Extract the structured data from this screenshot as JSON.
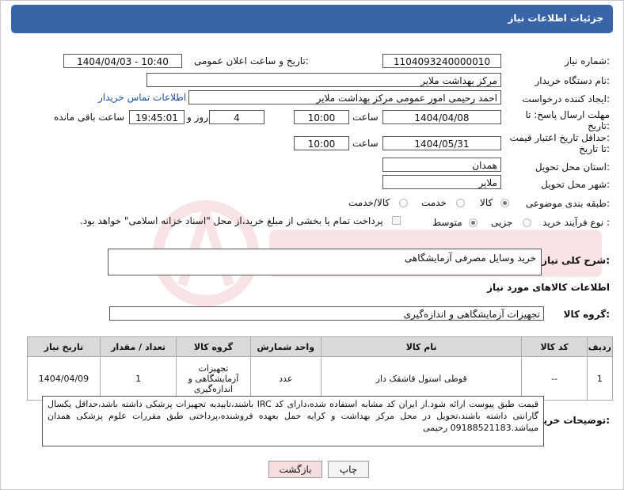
{
  "header": {
    "title": "جزئیات اطلاعات نیاز"
  },
  "fields": {
    "need_number_label": "شماره نیاز:",
    "need_number": "1104093240000010",
    "announce_label": "تاریخ و ساعت اعلان عمومی:",
    "announce_value": "1404/04/03 - 10:40",
    "buyer_org_label": "نام دستگاه خریدار:",
    "buyer_org": "مرکز بهداشت ملایر",
    "requester_label": "ایجاد کننده درخواست:",
    "requester": "احمد رحیمی امور عمومی مرکز بهداشت ملایر",
    "contact_link": "اطلاعات تماس خریدار",
    "deadline_label_1": "مهلت ارسال پاسخ: تا",
    "deadline_label_2": "تاریخ:",
    "deadline_date": "1404/04/08",
    "time_label": "ساعت",
    "deadline_time": "10:00",
    "days_value": "4",
    "days_label": "روز و",
    "remaining_time": "19:45:01",
    "remaining_label": "ساعت باقی مانده",
    "validity_label_1": "حداقل تاریخ اعتبار قیمت:",
    "validity_label_2": "تا تاریخ:",
    "validity_date": "1404/05/31",
    "validity_time": "10:00",
    "province_label": "استان محل تحویل:",
    "province": "همدان",
    "city_label": "شهر محل تحویل:",
    "city": "ملایر",
    "category_label": "طبقه بندی موضوعی:",
    "category_options": [
      "کالا",
      "خدمت",
      "کالا/خدمت"
    ],
    "category_selected": "کالا",
    "process_label": "نوع فرآیند خرید :",
    "process_options": [
      "جزیی",
      "متوسط"
    ],
    "process_selected": "متوسط",
    "payment_note": "پرداخت تمام یا بخشی از مبلغ خرید،از محل \"اسناد خزانه اسلامی\" خواهد بود.",
    "description_label": "شرح کلی نیاز:",
    "description": "خرید وسایل مصرفی آزمایشگاهی",
    "goods_info_title": "اطلاعات کالاهای مورد نیاز",
    "goods_group_label": "گروه کالا:",
    "goods_group": "تجهیزات آزمایشگاهی و اندازه‌گیری"
  },
  "table": {
    "headers": [
      "ردیف",
      "کد کالا",
      "نام کالا",
      "واحد شمارش",
      "گروه کالا",
      "تعداد / مقدار",
      "تاریخ نیاز"
    ],
    "rows": [
      [
        "1",
        "--",
        "قوطی استول قاشقک دار",
        "عدد",
        "تجهیزات آزمایشگاهی و اندازه‌گیری",
        "1",
        "1404/04/09"
      ]
    ]
  },
  "buyer_notes_label": "توضیحات خریدار:",
  "buyer_notes": "قیمت طبق پیوست ارائه شود.از ایران کد مشابه استفاده شده،دارای کد IRC باشند،تاییدیه تجهیزات پزشکی داشته باشد،حداقل یکسال گارانتی داشته باشند،تحویل در محل مرکز بهداشت و کرایه حمل بعهده فروشنده،پرداختی طبق مقررات علوم پزشکی همدان میباشد.09188521183 رحیمی",
  "buttons": {
    "print": "چاپ",
    "back": "بازگشت"
  },
  "colors": {
    "header_bg": "#3a64a8",
    "link": "#1d4fa8",
    "back_button_bg": "#f6dede"
  }
}
